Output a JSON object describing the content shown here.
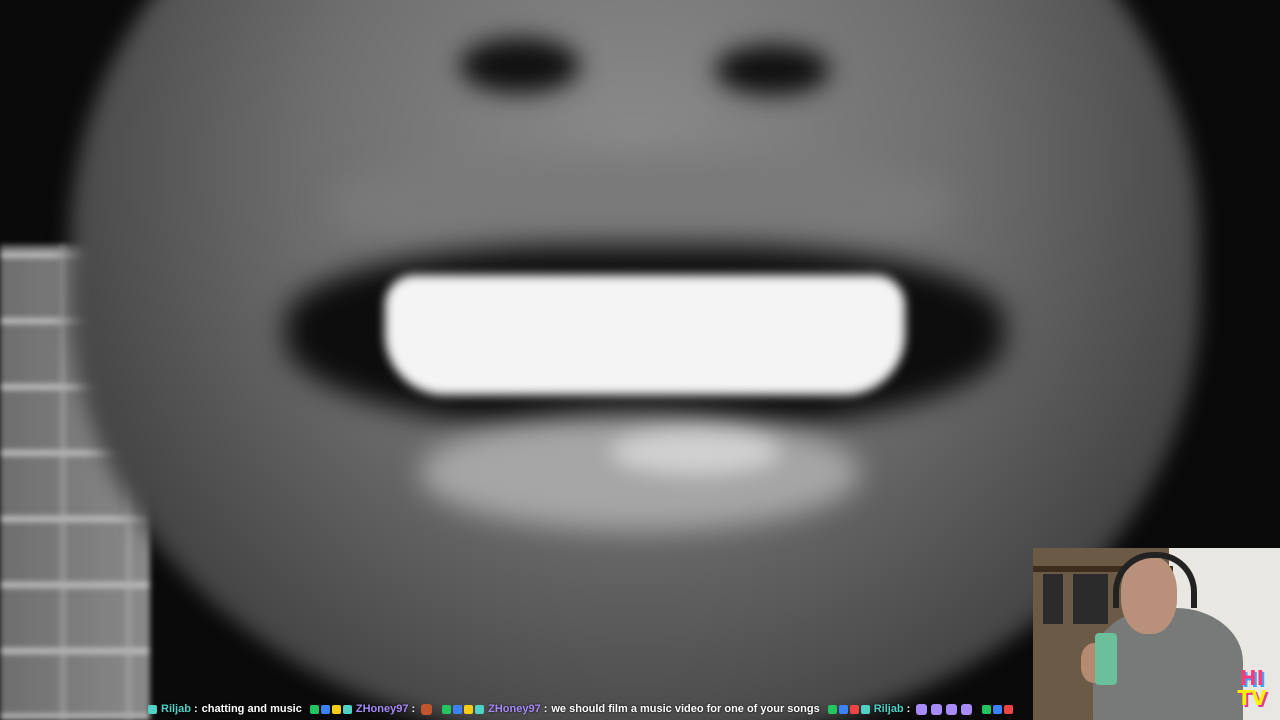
{
  "stream": {
    "logo_line1": "HI",
    "logo_line2": "TV"
  },
  "chat_ticker": {
    "messages": [
      {
        "username": "Riljab",
        "username_color": "#4fd1c5",
        "separator": ":",
        "text": "chatting and music",
        "badges": [
          "#4fd1c5"
        ]
      },
      {
        "username": "ZHoney97",
        "username_color": "#a78bfa",
        "separator": ":",
        "text": "",
        "badges": [
          "#22c55e",
          "#3b82f6",
          "#facc15",
          "#4fd1c5"
        ],
        "emotes": [
          "#c0552e"
        ]
      },
      {
        "username": "ZHoney97",
        "username_color": "#a78bfa",
        "separator": ":",
        "text": "we should film a music video for one of your songs",
        "badges": [
          "#22c55e",
          "#3b82f6",
          "#facc15",
          "#4fd1c5"
        ]
      },
      {
        "username": "Riljab",
        "username_color": "#4fd1c5",
        "separator": ":",
        "text": "",
        "badges": [
          "#22c55e",
          "#3b82f6",
          "#ef4444",
          "#4fd1c5"
        ],
        "emotes": [
          "#a78bfa",
          "#a78bfa",
          "#a78bfa",
          "#a78bfa"
        ]
      },
      {
        "username": "",
        "username_color": "#4fd1c5",
        "separator": "",
        "text": "",
        "badges": [
          "#22c55e",
          "#3b82f6",
          "#ef4444"
        ]
      }
    ]
  }
}
